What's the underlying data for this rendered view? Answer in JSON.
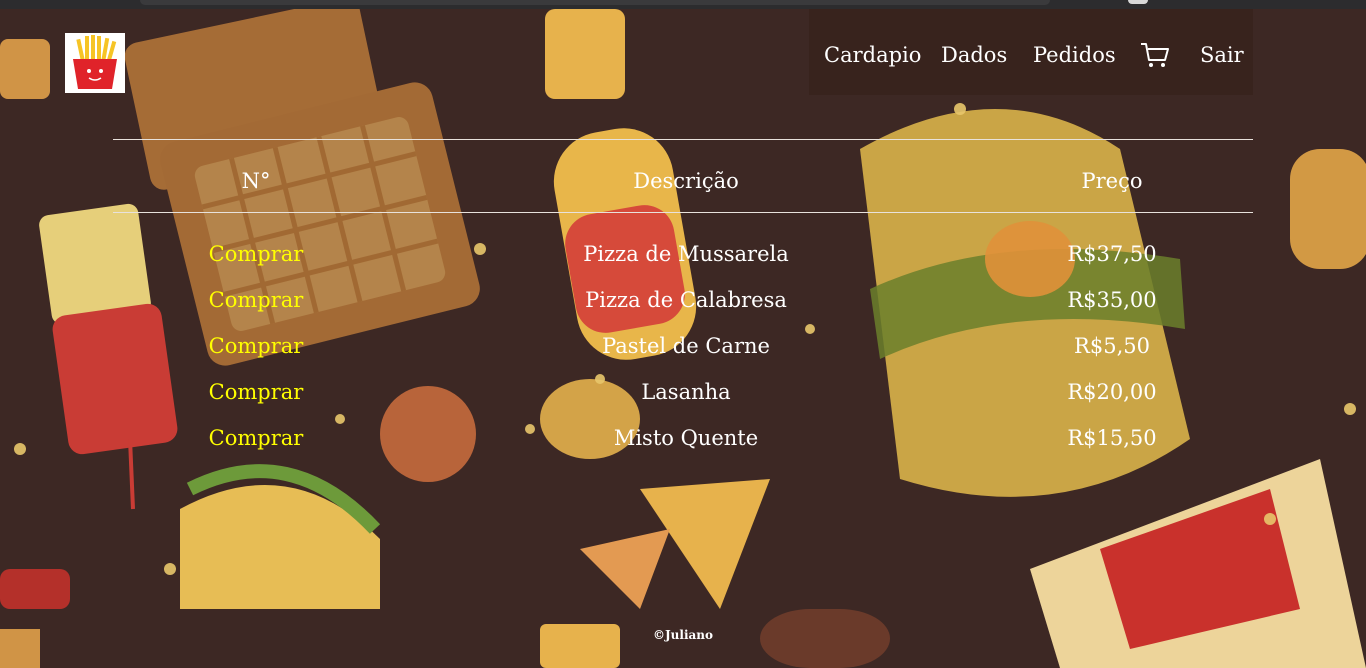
{
  "colors": {
    "background": "#3d2824",
    "link_yellow": "#ffff00",
    "text": "#ffffff"
  },
  "nav": {
    "cardapio": "Cardapio",
    "dados": "Dados",
    "pedidos": "Pedidos",
    "cart_icon": "cart-icon",
    "sair": "Sair"
  },
  "table": {
    "headers": [
      "N°",
      "Descrição",
      "Preço"
    ],
    "rows": [
      {
        "action": "Comprar",
        "description": "Pizza de Mussarela",
        "price": "R$37,50"
      },
      {
        "action": "Comprar",
        "description": "Pizza de Calabresa",
        "price": "R$35,00"
      },
      {
        "action": "Comprar",
        "description": "Pastel de Carne",
        "price": "R$5,50"
      },
      {
        "action": "Comprar",
        "description": "Lasanha",
        "price": "R$20,00"
      },
      {
        "action": "Comprar",
        "description": "Misto Quente",
        "price": "R$15,50"
      }
    ]
  },
  "footer": {
    "copyright": "©Juliano"
  }
}
